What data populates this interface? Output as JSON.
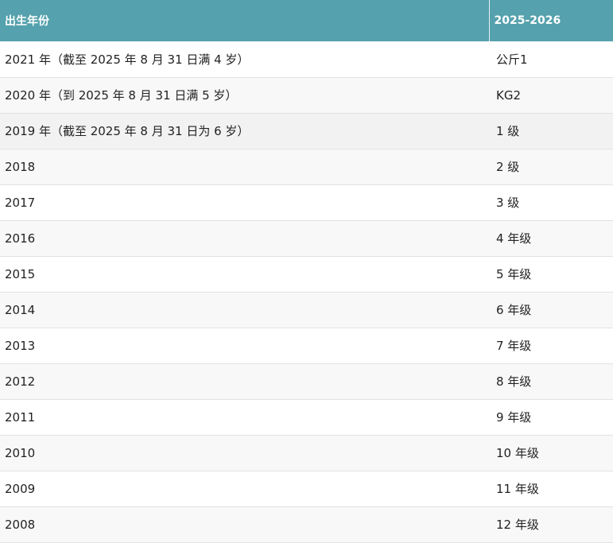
{
  "table": {
    "headers": [
      "出生年份",
      "2025-2026"
    ],
    "rows": [
      {
        "year": "2021 年（截至 2025 年 8 月 31 日满 4 岁）",
        "grade": "公斤1"
      },
      {
        "year": "2020 年（到 2025 年 8 月 31 日满 5 岁）",
        "grade": "KG2"
      },
      {
        "year": "2019 年（截至 2025 年 8 月 31 日为 6 岁）",
        "grade": "1 级"
      },
      {
        "year": "2018",
        "grade": "2 级"
      },
      {
        "year": "2017",
        "grade": "3 级"
      },
      {
        "year": "2016",
        "grade": "4 年级"
      },
      {
        "year": "2015",
        "grade": "5 年级"
      },
      {
        "year": "2014",
        "grade": "6 年级"
      },
      {
        "year": "2013",
        "grade": "7 年级"
      },
      {
        "year": "2012",
        "grade": "8 年级"
      },
      {
        "year": "2011",
        "grade": "9 年级"
      },
      {
        "year": "2010",
        "grade": "10 年级"
      },
      {
        "year": "2009",
        "grade": "11 年级"
      },
      {
        "year": "2008",
        "grade": "12 年级"
      }
    ]
  },
  "colors": {
    "header_bg": "#55a1ad",
    "header_text": "#ffffff",
    "row_alt_bg": "#f8f8f8",
    "border": "#e2e2e2"
  }
}
